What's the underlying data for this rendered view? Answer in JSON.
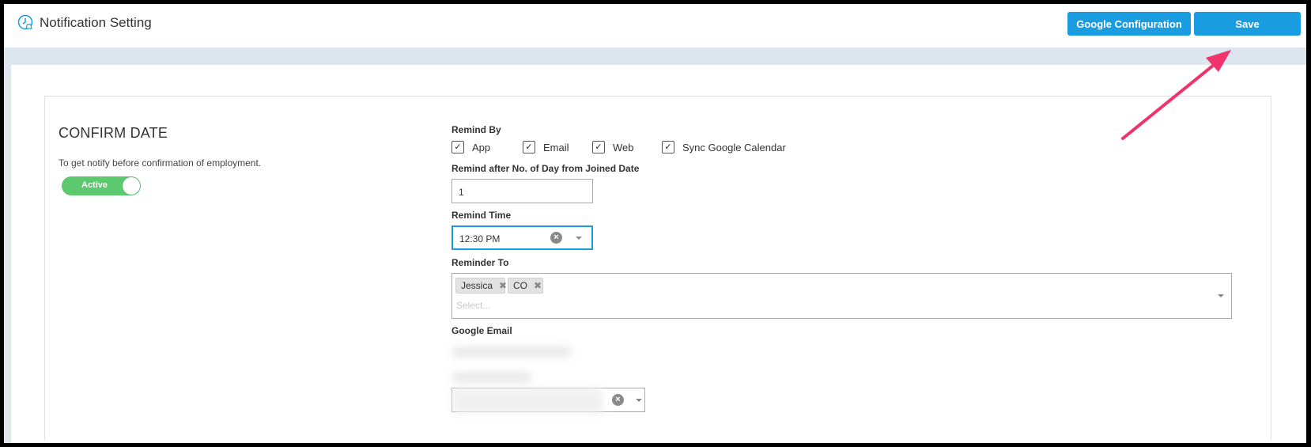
{
  "header": {
    "title": "Notification Setting",
    "google_config_label": "Google Configuration",
    "save_label": "Save"
  },
  "section": {
    "title": "CONFIRM DATE",
    "description": "To get notify before confirmation of employment.",
    "toggle_label": "Active",
    "toggle_on": true
  },
  "form": {
    "remind_by_label": "Remind By",
    "remind_by_options": [
      {
        "label": "App",
        "checked": true
      },
      {
        "label": "Email",
        "checked": true
      },
      {
        "label": "Web",
        "checked": true
      },
      {
        "label": "Sync Google Calendar",
        "checked": true
      }
    ],
    "remind_after_label": "Remind after No. of Day from Joined Date",
    "remind_after_value": "1",
    "remind_time_label": "Remind Time",
    "remind_time_value": "12:30 PM",
    "reminder_to_label": "Reminder To",
    "reminder_to_tags": [
      "Jessica",
      "CO"
    ],
    "reminder_to_placeholder": "Select...",
    "google_email_label": "Google Email"
  },
  "colors": {
    "primary": "#1a9ce0",
    "toggle_active": "#5cc96e",
    "annotation_arrow": "#f0336a"
  }
}
